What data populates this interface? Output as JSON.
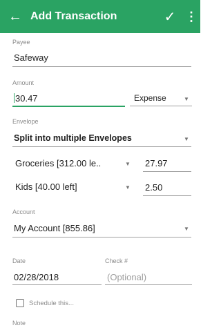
{
  "appbar": {
    "title": "Add Transaction",
    "back_icon": "arrow-left-icon",
    "save_icon": "check-icon",
    "menu_icon": "more-vert-icon",
    "color": "#2aa363"
  },
  "payee": {
    "label": "Payee",
    "value": "Safeway"
  },
  "amount": {
    "label": "Amount",
    "value": "30.47",
    "type_value": "Expense"
  },
  "envelope": {
    "label": "Envelope",
    "value": "Split into multiple Envelopes",
    "splits": [
      {
        "envelope": "Groceries  [312.00 le..",
        "amount": "27.97"
      },
      {
        "envelope": "Kids  [40.00 left]",
        "amount": "2.50"
      }
    ]
  },
  "account": {
    "label": "Account",
    "value": "My Account  [855.86]"
  },
  "date": {
    "label": "Date",
    "value": "02/28/2018"
  },
  "check": {
    "label": "Check #",
    "placeholder": "(Optional)"
  },
  "schedule": {
    "label": "Schedule this..."
  },
  "note": {
    "label": "Note"
  }
}
